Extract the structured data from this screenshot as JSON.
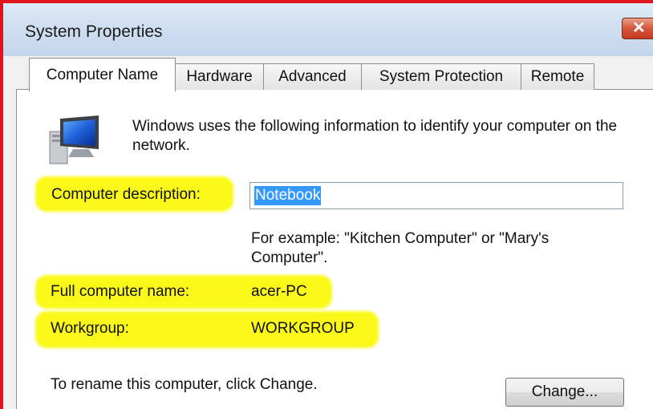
{
  "window": {
    "title": "System Properties"
  },
  "tabs": [
    {
      "label": "Computer Name",
      "active": true
    },
    {
      "label": "Hardware",
      "active": false
    },
    {
      "label": "Advanced",
      "active": false
    },
    {
      "label": "System Protection",
      "active": false
    },
    {
      "label": "Remote",
      "active": false
    }
  ],
  "intro_text": "Windows uses the following information to identify your computer on the network.",
  "description": {
    "label": "Computer description:",
    "value": "Notebook",
    "example": "For example: \"Kitchen Computer\" or \"Mary's Computer\"."
  },
  "full_name": {
    "label": "Full computer name:",
    "value": "acer-PC"
  },
  "workgroup": {
    "label": "Workgroup:",
    "value": "WORKGROUP"
  },
  "rename": {
    "text": "To rename this computer, click Change.",
    "button_label": "Change..."
  },
  "colors": {
    "highlight": "#fbf91a",
    "selection": "#3399ff",
    "border_red": "#e0141b"
  },
  "icons": {
    "close": "close-icon",
    "computer": "computer-icon"
  }
}
